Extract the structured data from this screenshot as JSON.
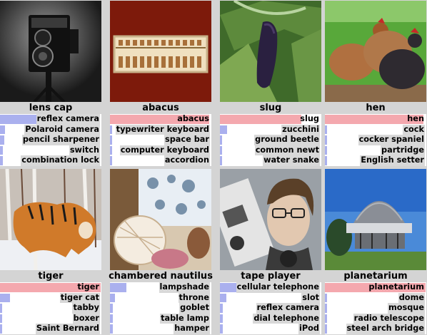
{
  "colors": {
    "correct_bar": "#f4a8ae",
    "other_bar": "#aab0ee",
    "label_bg": "#d8d8d8",
    "background": "#d4d4d4"
  },
  "cells": [
    {
      "title": "lens cap",
      "predictions": [
        {
          "label": "reflex camera",
          "score": 0.45,
          "correct": false
        },
        {
          "label": "Polaroid camera",
          "score": 0.05,
          "correct": false
        },
        {
          "label": "pencil sharpener",
          "score": 0.04,
          "correct": false
        },
        {
          "label": "switch",
          "score": 0.03,
          "correct": false
        },
        {
          "label": "combination lock",
          "score": 0.03,
          "correct": false
        }
      ]
    },
    {
      "title": "abacus",
      "predictions": [
        {
          "label": "abacus",
          "score": 0.98,
          "correct": true
        },
        {
          "label": "typewriter keyboard",
          "score": 0.01,
          "correct": false
        },
        {
          "label": "space bar",
          "score": 0.01,
          "correct": false
        },
        {
          "label": "computer keyboard",
          "score": 0.01,
          "correct": false
        },
        {
          "label": "accordion",
          "score": 0.01,
          "correct": false
        }
      ]
    },
    {
      "title": "slug",
      "predictions": [
        {
          "label": "slug",
          "score": 0.8,
          "correct": true
        },
        {
          "label": "zucchini",
          "score": 0.07,
          "correct": false
        },
        {
          "label": "ground beetle",
          "score": 0.02,
          "correct": false
        },
        {
          "label": "common newt",
          "score": 0.02,
          "correct": false
        },
        {
          "label": "water snake",
          "score": 0.01,
          "correct": false
        }
      ]
    },
    {
      "title": "hen",
      "predictions": [
        {
          "label": "hen",
          "score": 0.97,
          "correct": true
        },
        {
          "label": "cock",
          "score": 0.01,
          "correct": false
        },
        {
          "label": "cocker spaniel",
          "score": 0.01,
          "correct": false
        },
        {
          "label": "partridge",
          "score": 0.01,
          "correct": false
        },
        {
          "label": "English setter",
          "score": 0.01,
          "correct": false
        }
      ]
    },
    {
      "title": "tiger",
      "predictions": [
        {
          "label": "tiger",
          "score": 0.99,
          "correct": true
        },
        {
          "label": "tiger cat",
          "score": 0.1,
          "correct": false
        },
        {
          "label": "tabby",
          "score": 0.01,
          "correct": false
        },
        {
          "label": "boxer",
          "score": 0.01,
          "correct": false
        },
        {
          "label": "Saint Bernard",
          "score": 0.01,
          "correct": false
        }
      ]
    },
    {
      "title": "chambered nautilus",
      "predictions": [
        {
          "label": "lampshade",
          "score": 0.16,
          "correct": false
        },
        {
          "label": "throne",
          "score": 0.05,
          "correct": false
        },
        {
          "label": "goblet",
          "score": 0.03,
          "correct": false
        },
        {
          "label": "table lamp",
          "score": 0.03,
          "correct": false
        },
        {
          "label": "hamper",
          "score": 0.03,
          "correct": false
        }
      ]
    },
    {
      "title": "tape player",
      "predictions": [
        {
          "label": "cellular telephone",
          "score": 0.24,
          "correct": false
        },
        {
          "label": "slot",
          "score": 0.06,
          "correct": false
        },
        {
          "label": "reflex camera",
          "score": 0.03,
          "correct": false
        },
        {
          "label": "dial telephone",
          "score": 0.03,
          "correct": false
        },
        {
          "label": "iPod",
          "score": 0.03,
          "correct": false
        }
      ]
    },
    {
      "title": "planetarium",
      "predictions": [
        {
          "label": "planetarium",
          "score": 0.99,
          "correct": true
        },
        {
          "label": "dome",
          "score": 0.01,
          "correct": false
        },
        {
          "label": "mosque",
          "score": 0.01,
          "correct": false
        },
        {
          "label": "radio telescope",
          "score": 0.01,
          "correct": false
        },
        {
          "label": "steel arch bridge",
          "score": 0.01,
          "correct": false
        }
      ]
    }
  ]
}
